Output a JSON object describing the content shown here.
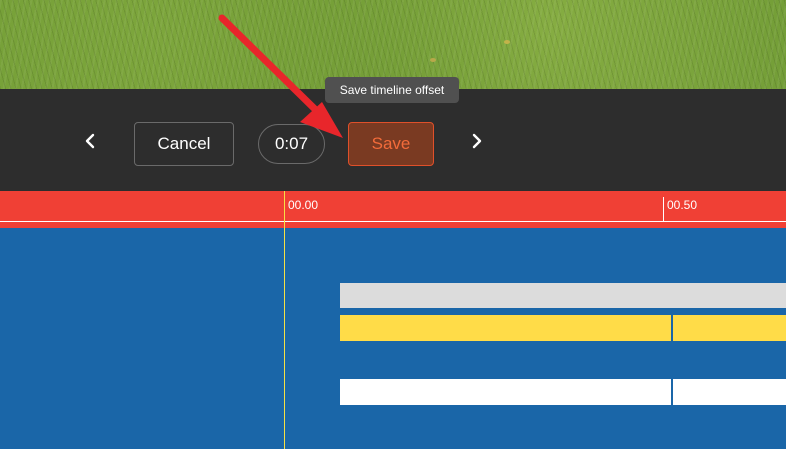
{
  "controls": {
    "prev_icon": "chevron-left-icon",
    "next_icon": "chevron-right-icon",
    "cancel_label": "Cancel",
    "time_value": "0:07",
    "save_label": "Save",
    "save_tooltip": "Save timeline offset"
  },
  "timeline": {
    "ticks": [
      "00.00",
      "00.50"
    ]
  },
  "colors": {
    "ruler": "#f04035",
    "track_bg": "#1a66a8",
    "playhead": "#f7e045",
    "save_accent": "#f26b3a",
    "annotation_arrow": "#e8262b"
  }
}
